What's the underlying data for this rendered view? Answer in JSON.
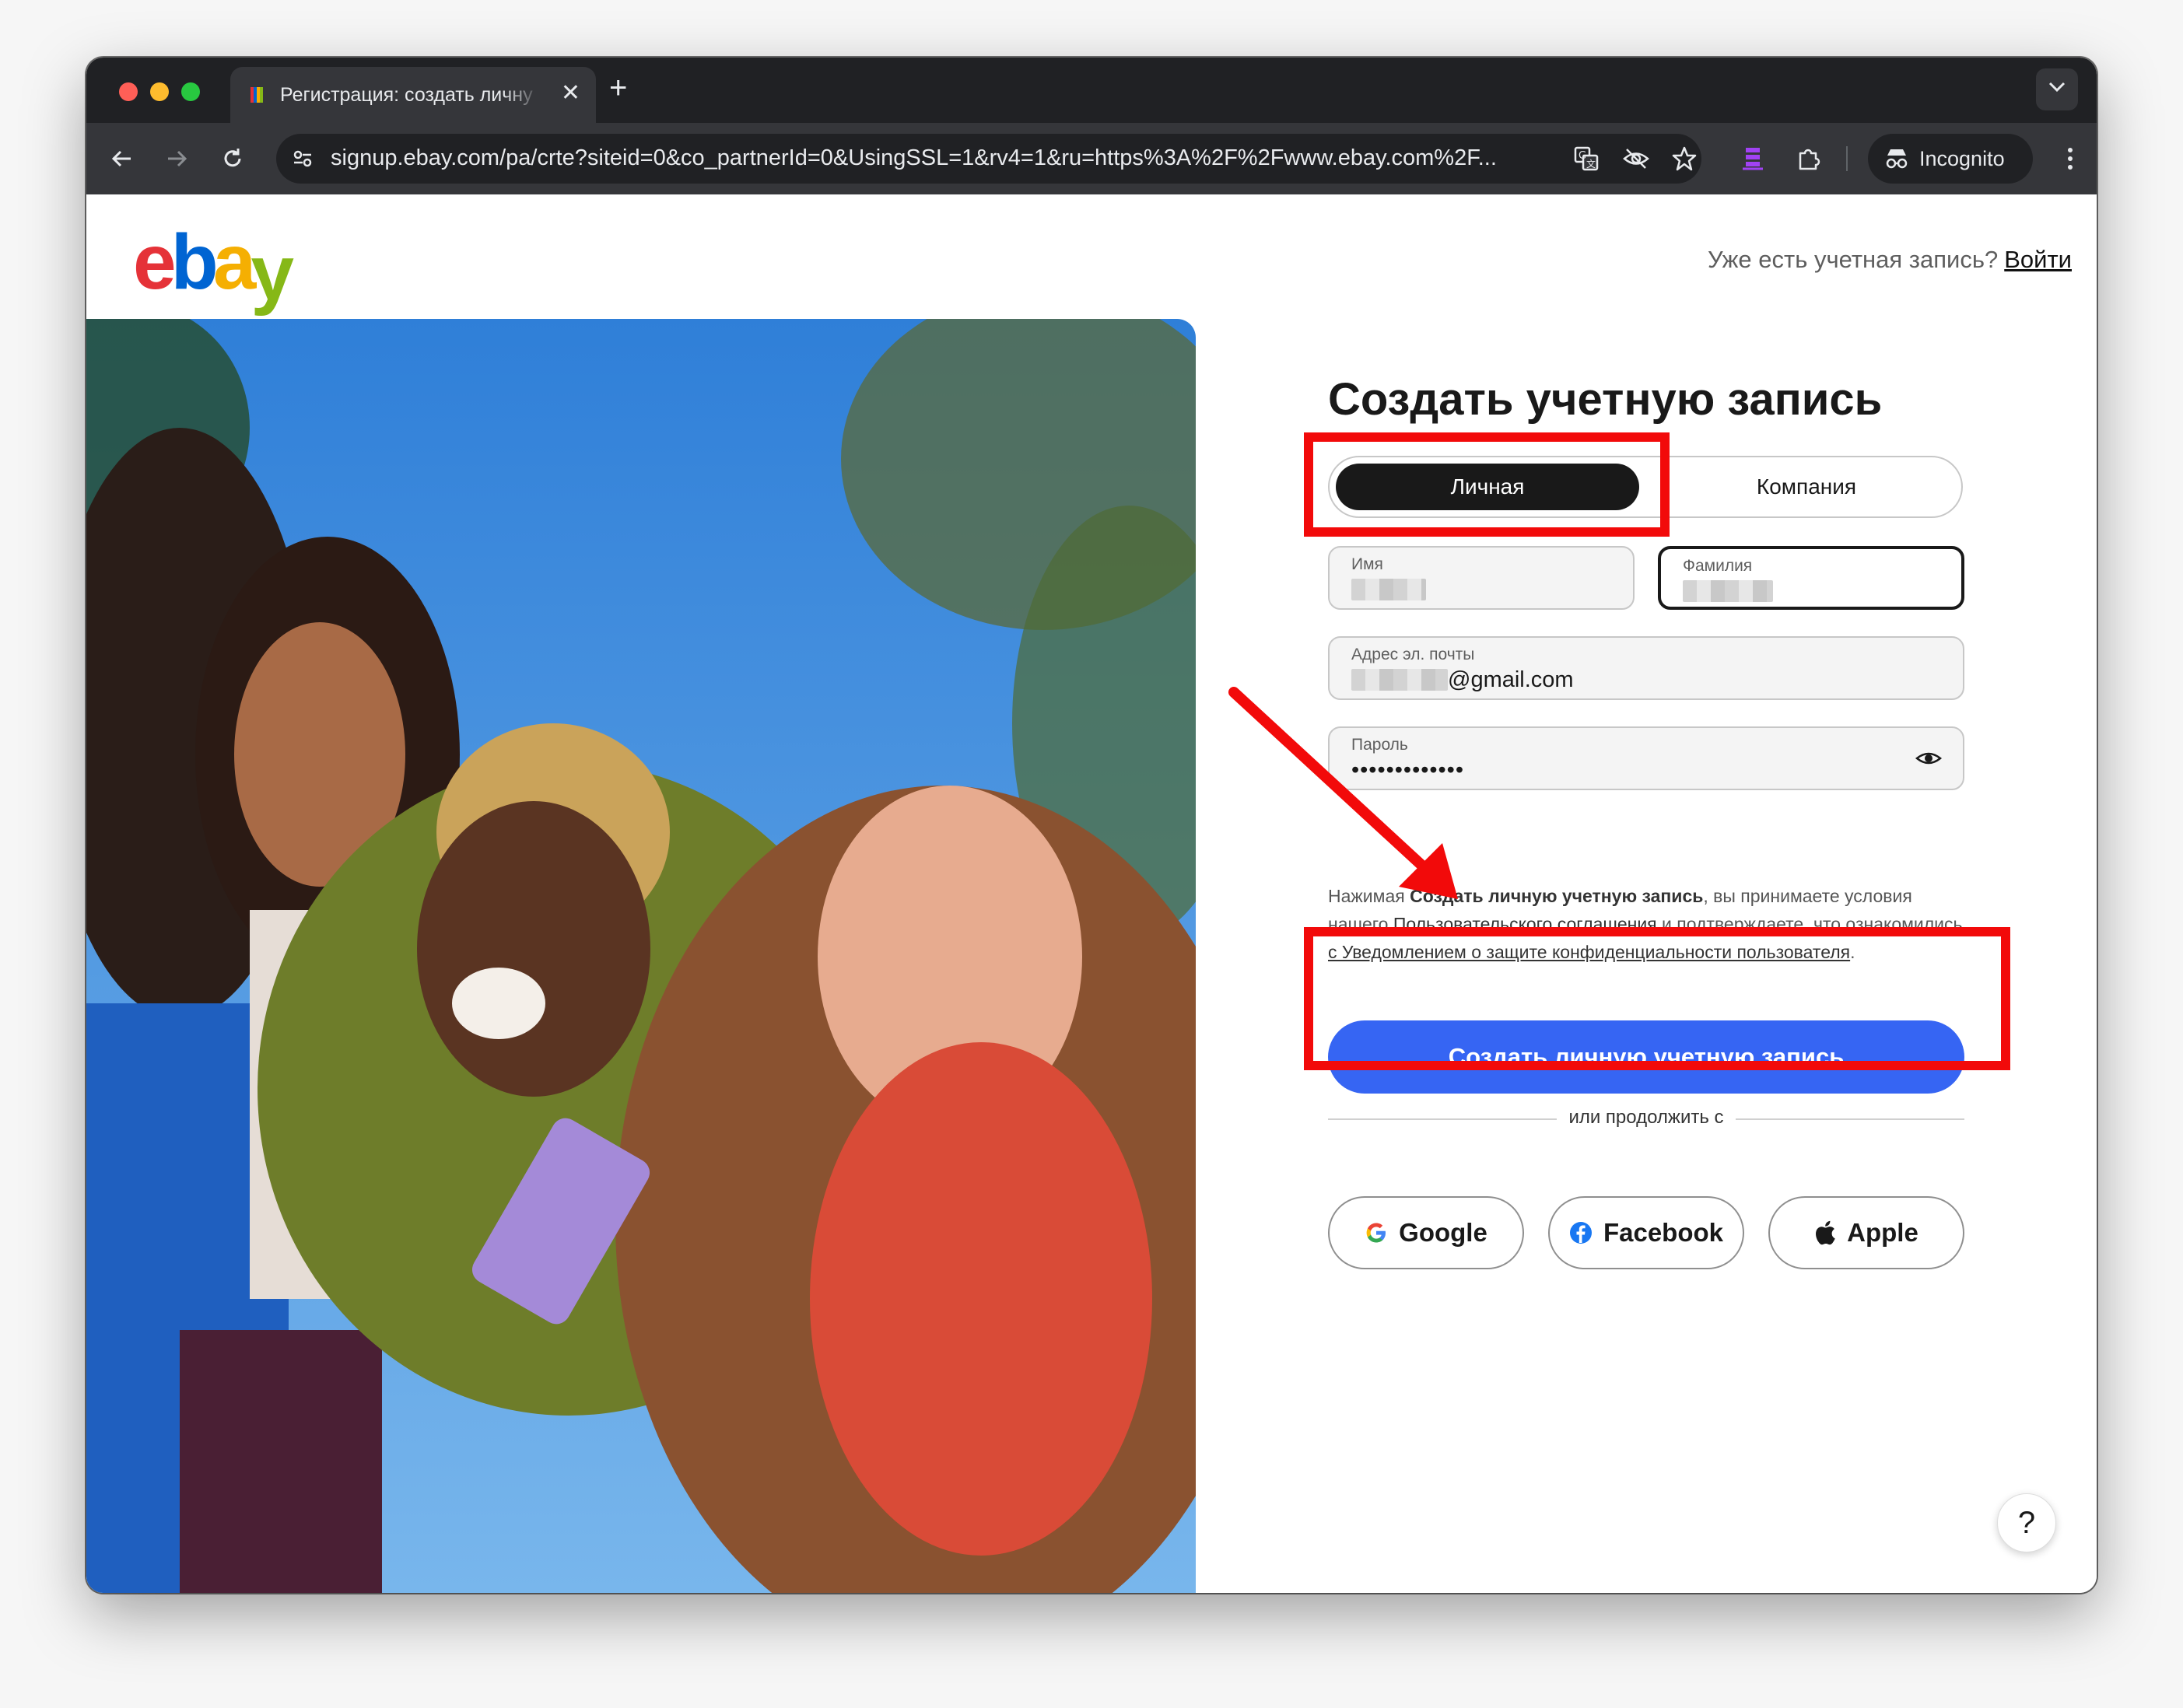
{
  "browser": {
    "tab_title": "Регистрация: создать личну",
    "new_tab": "+",
    "close_tab": "✕",
    "url": "signup.ebay.com/pa/crte?siteid=0&co_partnerId=0&UsingSSL=1&rv4=1&ru=https%3A%2F%2Fwww.ebay.com%2F...",
    "incognito_label": "Incognito",
    "traffic_colors": [
      "#ff5f57",
      "#febc2e",
      "#28c840"
    ]
  },
  "header": {
    "logo": {
      "e": "e",
      "b": "b",
      "a": "a",
      "y": "y"
    },
    "logo_colors": [
      "#e53238",
      "#0064d2",
      "#f5af02",
      "#86b817"
    ],
    "signin_prompt": "Уже есть учетная запись?",
    "signin_link": "Войти"
  },
  "form": {
    "title": "Создать учетную запись",
    "account_types": {
      "personal": "Личная",
      "business": "Компания",
      "selected": "personal"
    },
    "first_name": {
      "label": "Имя"
    },
    "last_name": {
      "label": "Фамилия"
    },
    "email": {
      "label": "Адрес эл. почты",
      "value_suffix": "@gmail.com"
    },
    "password": {
      "label": "Пароль",
      "value": "•••••••••••••"
    },
    "legal": {
      "pre": "Нажимая ",
      "bold": "Создать личную учетную запись",
      "mid": ", вы принимаете условия нашего ",
      "link1": "Пользовательского соглашения",
      "mid2": " и подтверждаете, что ознакомились ",
      "link2": "с Уведомлением о защите конфиденциальности пользователя",
      "end": "."
    },
    "submit": "Создать личную учетную запись",
    "divider": "или продолжить с",
    "social": {
      "google": "Google",
      "facebook": "Facebook",
      "apple": "Apple"
    }
  },
  "help": "?",
  "annotation_color": "#f20a0a",
  "accent": "#3665f3"
}
